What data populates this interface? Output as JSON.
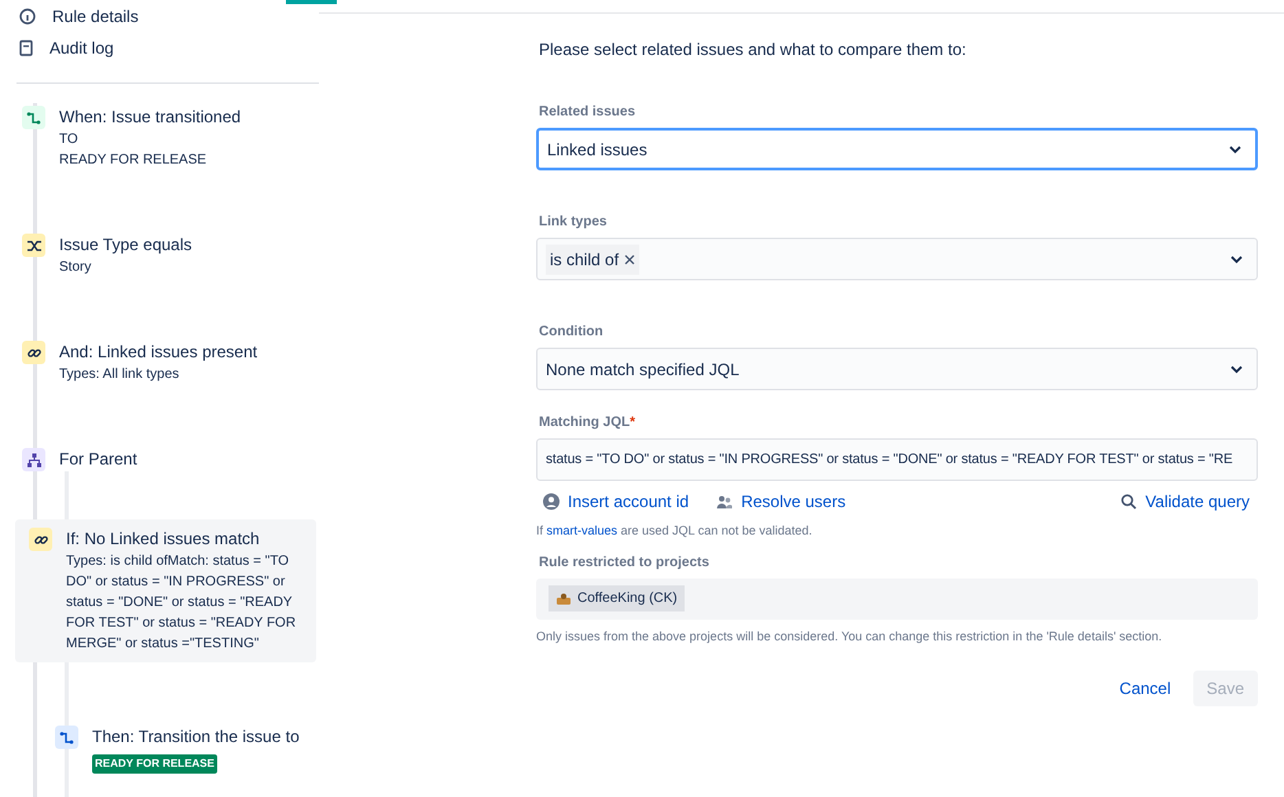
{
  "sidebar": {
    "nav": [
      {
        "label": "Rule details"
      },
      {
        "label": "Audit log"
      }
    ],
    "steps": [
      {
        "kind": "trigger",
        "title": "When: Issue transitioned",
        "lines": [
          "TO",
          "READY FOR RELEASE"
        ],
        "selected": false
      },
      {
        "kind": "condition",
        "title": "Issue Type equals",
        "lines": [
          "Story"
        ],
        "selected": false
      },
      {
        "kind": "link",
        "title": "And: Linked issues present",
        "lines": [
          "Types: All link types"
        ],
        "selected": false
      },
      {
        "kind": "branch",
        "title": "For Parent",
        "selected": false,
        "children": [
          {
            "kind": "link",
            "title": "If: No Linked issues match",
            "lines": [
              "Types: is child ofMatch: status = \"TO DO\" or status = \"IN PROGRESS\" or status = \"DONE\" or status = \"READY FOR TEST\" or status = \"READY FOR MERGE\" or status =\"TESTING\""
            ],
            "selected": true
          },
          {
            "kind": "action",
            "title": "Then: Transition the issue to",
            "lozenge": "READY FOR RELEASE",
            "selected": false
          }
        ]
      }
    ]
  },
  "form": {
    "intro": "Please select related issues and what to compare them to:",
    "fields": [
      {
        "kind": "select",
        "label": "Related issues",
        "value": "Linked issues",
        "focused": true
      },
      {
        "kind": "multiselect",
        "label": "Link types",
        "tags": [
          "is child of"
        ],
        "focused": false
      },
      {
        "kind": "select",
        "label": "Condition",
        "value": "None match specified JQL",
        "focused": false
      },
      {
        "kind": "input",
        "label": "Matching JQL",
        "required_mark": "*",
        "value": "status = \"TO DO\" or status = \"IN PROGRESS\" or status = \"DONE\" or status = \"READY FOR TEST\" or status = \"RE",
        "focused": false
      }
    ],
    "jql_actions": [
      {
        "label": "Insert account id"
      },
      {
        "label": "Resolve users"
      },
      {
        "label": "Validate query"
      }
    ],
    "hint": {
      "before": "If ",
      "link": "smart-values",
      "after": " are used JQL can not be validated."
    },
    "projects": {
      "label": "Rule restricted to projects",
      "items": [
        "CoffeeKing (CK)"
      ],
      "note": "Only issues from the above projects will be considered. You can change this restriction in the 'Rule details' section."
    },
    "buttons": [
      {
        "label": "Cancel",
        "kind": "link",
        "disabled": false
      },
      {
        "label": "Save",
        "kind": "primary",
        "disabled": true
      }
    ]
  }
}
